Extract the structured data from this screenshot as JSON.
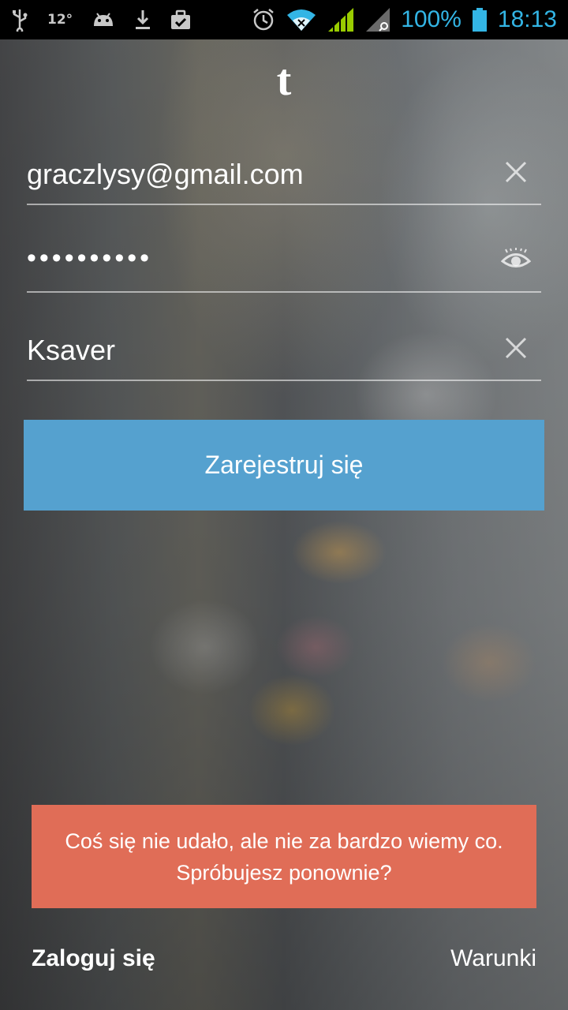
{
  "status_bar": {
    "temperature": "12°",
    "battery_text": "100%",
    "time": "18:13",
    "icons_left": [
      "usb-icon",
      "temperature-icon",
      "android-icon",
      "download-icon",
      "briefcase-icon"
    ],
    "icons_right": [
      "alarm-icon",
      "wifi-icon",
      "signal-icon",
      "signal-search-icon",
      "battery-icon"
    ],
    "accent_color": "#33b5e5"
  },
  "app": {
    "logo": "t"
  },
  "form": {
    "email": "graczlysy@gmail.com",
    "password_mask": "••••••••••",
    "username": "Ksaver",
    "clear_icon": "close-icon",
    "reveal_icon": "eye-icon"
  },
  "actions": {
    "register_label": "Zarejestruj się",
    "register_color": "#55a1cf"
  },
  "error": {
    "line1": "Coś się nie udało, ale nie za bardzo wiemy co.",
    "line2": "Spróbujesz ponownie?",
    "color": "#e06d57"
  },
  "footer": {
    "login_label": "Zaloguj się",
    "terms_label": "Warunki"
  }
}
